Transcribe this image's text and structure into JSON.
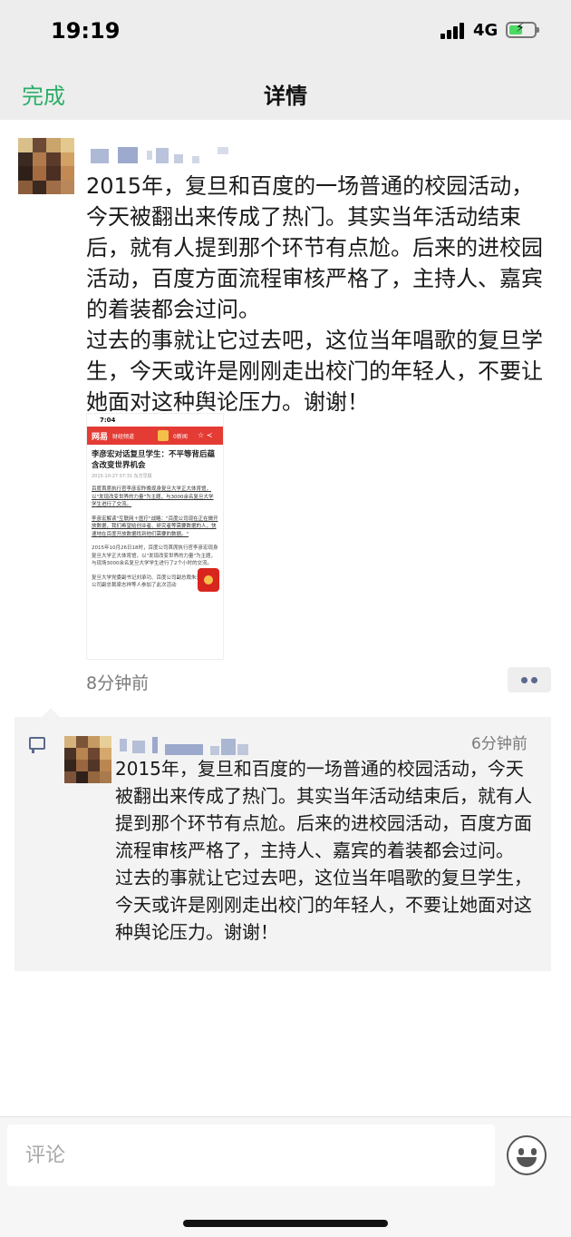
{
  "status_bar": {
    "time": "19:19",
    "network": "4G",
    "battery_level": 0.55,
    "battery_color": "#4cd964"
  },
  "nav": {
    "done_label": "完成",
    "title": "详情",
    "accent_color": "#2aae67"
  },
  "post": {
    "text": "2015年，复旦和百度的一场普通的校园活动，今天被翻出来传成了热门。其实当年活动结束后，就有人提到那个环节有点尬。后来的进校园活动，百度方面流程审核严格了，主持人、嘉宾的着装都会过问。\n过去的事就让它过去吧，这位当年唱歌的复旦学生，今天或许是刚刚走出校门的年轻人，不要让她面对这种舆论压力。谢谢！",
    "time": "8分钟前",
    "more_icon": "more-dots-icon",
    "image": {
      "status_time": "7:04",
      "app_logo": "网易",
      "app_sub": "财经频道",
      "header_right_1": "0新闻",
      "header_right_2": "☆ ≺",
      "headline": "李彦宏对话复旦学生：不平等背后蕴含改变世界机会",
      "meta": "2015-10-27 07:31  东方早报",
      "paragraphs": [
        "百度首席执行官李彦宏昨晚现身复旦大学正大体育馆，以\"发现改变世界的力量\"为主题，与3000余名复旦大学学生进行了交流。",
        "李彦宏解读\"互联网＋医疗\"战略：\"百度公司现在正在做开放数据，我们希望给创业者、研究者等需要数据的人，快速地在百度开放数据找到他们需要的数据。\"",
        "2015年10月26日18时，百度公司首席执行官李彦宏现身复旦大学正大体育馆，以\"发现改变世界的力量\"为主题，与现场3000余名复旦大学学生进行了2个小时的交流。",
        "复旦大学党委副书记刘承功、百度公司副总裁朱光、百度公司副总裁梁志祥等人参加了此次活动"
      ]
    }
  },
  "reply": {
    "time": "6分钟前",
    "text": "2015年，复旦和百度的一场普通的校园活动，今天被翻出来传成了热门。其实当年活动结束后，就有人提到那个环节有点尬。后来的进校园活动，百度方面流程审核严格了，主持人、嘉宾的着装都会过问。\n过去的事就让它过去吧，这位当年唱歌的复旦学生，今天或许是刚刚走出校门的年轻人，不要让她面对这种舆论压力。谢谢！"
  },
  "bottom_bar": {
    "comment_placeholder": "评论",
    "emoji_icon": "emoji-face-icon"
  }
}
